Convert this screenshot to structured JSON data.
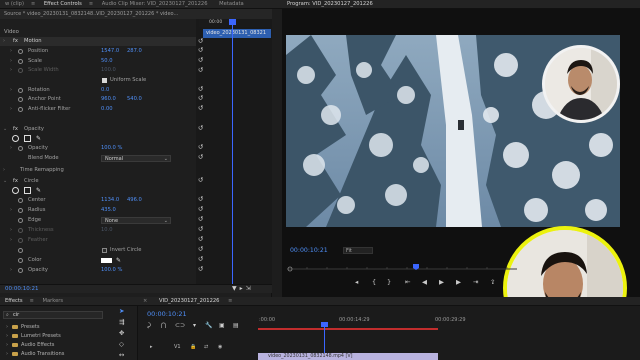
{
  "panel_tabs": {
    "left": [
      {
        "label": "w (clip)",
        "active": false
      },
      {
        "label": "Effect Controls",
        "active": true
      },
      {
        "label": "Audio Clip Mixer: VID_20230127_201226",
        "active": false
      },
      {
        "label": "Metadata",
        "active": false
      }
    ],
    "right_title": "Program: VID_20230127_201226"
  },
  "effect_controls": {
    "source_label": "Source * video_20230131_0832148...",
    "sequence_label": "VID_20230127_201226 * video...",
    "clip_label": "video_20230131_08321",
    "ruler_time": "00:00",
    "sections": {
      "video": "Video",
      "motion": "Motion",
      "opacity": "Opacity",
      "time_remapping": "Time Remapping",
      "circle": "Circle"
    },
    "motion": {
      "position_label": "Position",
      "position_x": "1547.0",
      "position_y": "287.0",
      "scale_label": "Scale",
      "scale_value": "50.0",
      "scale_width_label": "Scale Width",
      "scale_width_value": "100.0",
      "uniform_scale_label": "Uniform Scale",
      "rotation_label": "Rotation",
      "rotation_value": "0.0",
      "anchor_label": "Anchor Point",
      "anchor_x": "960.0",
      "anchor_y": "540.0",
      "flicker_label": "Anti-flicker Filter",
      "flicker_value": "0.00"
    },
    "opacity": {
      "opacity_label": "Opacity",
      "opacity_value": "100.0 %",
      "blend_label": "Blend Mode",
      "blend_value": "Normal"
    },
    "circle": {
      "center_label": "Center",
      "center_x": "1134.0",
      "center_y": "496.0",
      "radius_label": "Radius",
      "radius_value": "435.0",
      "edge_label": "Edge",
      "edge_value": "None",
      "thickness_label": "Thickness",
      "thickness_value": "10.0",
      "feather_label": "Feather",
      "invert_label": "Invert Circle",
      "color_label": "Color",
      "opacity_label": "Opacity",
      "opacity_value": "100.0 %"
    },
    "footer_time": "00:00:10:21"
  },
  "program": {
    "timecode": "00:00:10:21",
    "zoom": "Fit"
  },
  "effects_panel": {
    "tabs": [
      {
        "label": "Effects",
        "active": true
      },
      {
        "label": "Markers",
        "active": false
      }
    ],
    "search_value": "cir",
    "items": [
      "Presets",
      "Lumetri Presets",
      "Audio Effects",
      "Audio Transitions"
    ]
  },
  "timeline": {
    "tab_label": "VID_20230127_201226",
    "timecode": "00:00:10:21",
    "ruler_ticks": [
      ":00:00",
      "00:00:14:29",
      "00:00:29:29"
    ],
    "track_v1": "V1",
    "clip_label": "video_20230131_0832148.mp4 [V]"
  },
  "colors": {
    "accent_blue": "#4f8ff7",
    "playhead": "#3b66ff",
    "cam_ring_yellow": "#ecf20e",
    "cam_ring_white": "#f2f2f2"
  }
}
